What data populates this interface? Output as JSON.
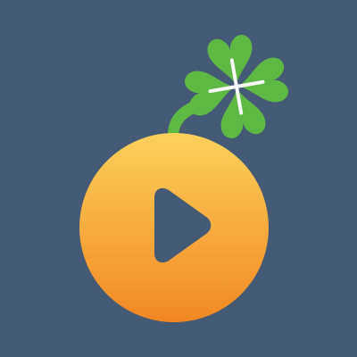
{
  "app_icon": {
    "icon_name": "orange-play-icon-with-clover",
    "colors": {
      "background": "#455a74",
      "orange_top": "#fbd15b",
      "orange_bottom": "#f28723",
      "play_button": "#455a74",
      "clover_fill": "#5db844",
      "clover_center": "#ffffff",
      "stem": "#5db844"
    }
  }
}
